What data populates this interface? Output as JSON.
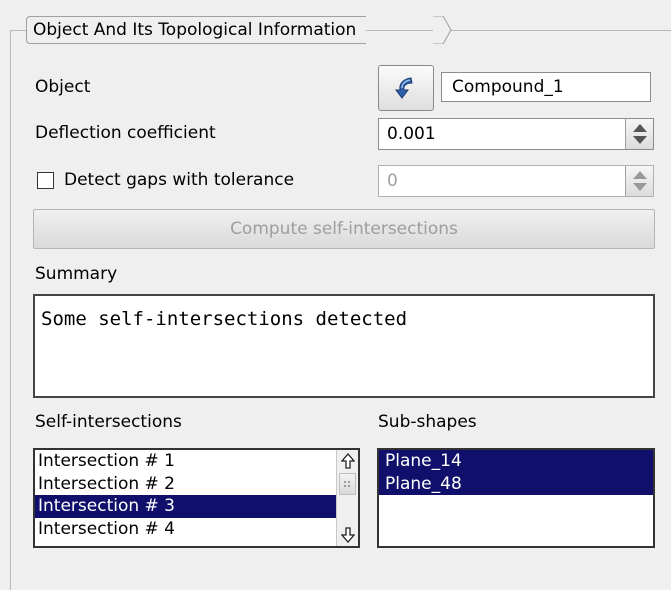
{
  "group": {
    "title": "Object And Its Topological Information"
  },
  "object": {
    "label": "Object",
    "value": "Compound_1"
  },
  "deflection": {
    "label": "Deflection coefficient",
    "value": "0.001"
  },
  "gaps": {
    "label": "Detect gaps with tolerance",
    "checked": false,
    "value": "0"
  },
  "compute": {
    "label": "Compute self-intersections"
  },
  "summary": {
    "label": "Summary",
    "text": "Some self-intersections detected"
  },
  "intersections": {
    "label": "Self-intersections",
    "items": [
      "Intersection # 1",
      "Intersection # 2",
      "Intersection # 3",
      "Intersection # 4"
    ],
    "selected_index": 2
  },
  "subshapes": {
    "label": "Sub-shapes",
    "items": [
      "Plane_14",
      "Plane_48"
    ]
  },
  "colors": {
    "selection": "#10106c",
    "panel": "#efefef"
  },
  "icons": {
    "pick": "curved-arrow-icon",
    "up": "arrow-up-icon",
    "down": "arrow-down-icon"
  }
}
